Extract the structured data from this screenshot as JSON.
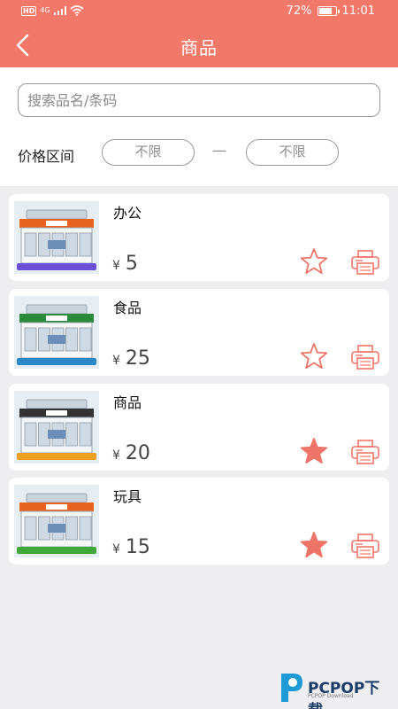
{
  "status": {
    "network": "4G",
    "hd": "HD",
    "battery": "72%",
    "time": "11:01"
  },
  "header": {
    "title": "商品",
    "back_icon": "chevron-left-icon"
  },
  "search": {
    "placeholder": "搜索品名/条码",
    "value": ""
  },
  "price_filter": {
    "label": "价格区间",
    "min": "不限",
    "separator": "—",
    "max": "不限"
  },
  "colors": {
    "header_bg": "#f2786a",
    "accent": "#ef7468",
    "page_bg": "#eeeef1"
  },
  "products": [
    {
      "name": "办公",
      "currency": "¥",
      "price": "5",
      "favorited": false,
      "roof_color": "#e8621f",
      "base_color": "#6a4fd6"
    },
    {
      "name": "食品",
      "currency": "¥",
      "price": "25",
      "favorited": false,
      "roof_color": "#2b8a3a",
      "base_color": "#2a86c4"
    },
    {
      "name": "商品",
      "currency": "¥",
      "price": "20",
      "favorited": true,
      "roof_color": "#333333",
      "base_color": "#f0a020"
    },
    {
      "name": "玩具",
      "currency": "¥",
      "price": "15",
      "favorited": true,
      "roof_color": "#e8621f",
      "base_color": "#3fa83a"
    }
  ],
  "watermark": {
    "text": "PCPOP下载",
    "sub": "PCPOP Download"
  }
}
